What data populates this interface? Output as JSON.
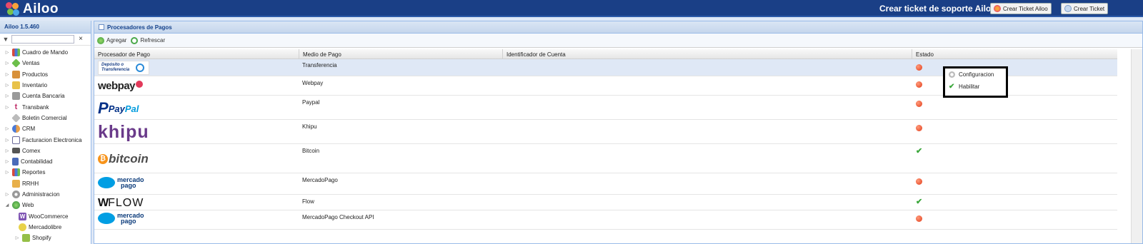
{
  "app": {
    "name": "Ailoo",
    "version": "Ailoo 1.5.460"
  },
  "topbar": {
    "support_text": "Crear ticket de soporte Ailoo ☛",
    "btn_ticket_ailoo": "Crear Ticket Ailoo",
    "btn_ticket": "Crear Ticket"
  },
  "sidebar": {
    "filter_placeholder": "",
    "items": [
      {
        "label": "Cuadro de Mando",
        "icon": "chart-icon",
        "color": "#d84a3a"
      },
      {
        "label": "Ventas",
        "icon": "tag-icon",
        "color": "#6cbf4a"
      },
      {
        "label": "Productos",
        "icon": "box-icon",
        "color": "#d8913a"
      },
      {
        "label": "Inventario",
        "icon": "package-icon",
        "color": "#e8c24a"
      },
      {
        "label": "Cuenta Bancaria",
        "icon": "bank-icon",
        "color": "#8a8a8a"
      },
      {
        "label": "Transbank",
        "icon": "transbank-icon",
        "color": "#c0306a"
      },
      {
        "label": "Boletin Comercial",
        "icon": "tag-gray-icon",
        "color": "#aaaaaa"
      },
      {
        "label": "CRM",
        "icon": "users-icon",
        "color": "#4a7ad8"
      },
      {
        "label": "Facturacion Electronica",
        "icon": "document-icon",
        "color": "#6a6a9a"
      },
      {
        "label": "Comex",
        "icon": "truck-icon",
        "color": "#555555"
      },
      {
        "label": "Contabilidad",
        "icon": "calculator-icon",
        "color": "#4a6ab8"
      },
      {
        "label": "Reportes",
        "icon": "report-icon",
        "color": "#d84a3a"
      },
      {
        "label": "RRHH",
        "icon": "folder-users-icon",
        "color": "#e8b04a"
      },
      {
        "label": "Administracion",
        "icon": "gear-icon",
        "color": "#999999"
      },
      {
        "label": "Web",
        "icon": "globe-icon",
        "color": "#4aa84a"
      },
      {
        "label": "WooCommerce",
        "icon": "woocommerce-icon",
        "color": "#7f54b3"
      },
      {
        "label": "Mercadolibre",
        "icon": "mercadolibre-icon",
        "color": "#e8d24a"
      },
      {
        "label": "Shopify",
        "icon": "shopify-icon",
        "color": "#95bf47"
      }
    ]
  },
  "panel": {
    "title": "Procesadores de Pagos",
    "toolbar": {
      "add": "Agregar",
      "refresh": "Refrescar"
    },
    "columns": [
      "Procesador de Pago",
      "Medio de Pago",
      "Identificador de Cuenta",
      "Estado"
    ],
    "rows": [
      {
        "logo": "Depósito o Transferencia",
        "medio": "Transferencia",
        "identificador": "",
        "estado": "disabled"
      },
      {
        "logo": "webpay",
        "medio": "Webpay",
        "identificador": "",
        "estado": "disabled"
      },
      {
        "logo": "PayPal",
        "medio": "Paypal",
        "identificador": "",
        "estado": "disabled"
      },
      {
        "logo": "khipu",
        "medio": "Khipu",
        "identificador": "",
        "estado": "disabled"
      },
      {
        "logo": "bitcoin",
        "medio": "Bitcoin",
        "identificador": "",
        "estado": "enabled"
      },
      {
        "logo": "mercado pago",
        "medio": "MercadoPago",
        "identificador": "",
        "estado": "disabled"
      },
      {
        "logo": "FLOW",
        "medio": "Flow",
        "identificador": "",
        "estado": "enabled"
      },
      {
        "logo": "mercado pago",
        "medio": "MercadoPago Checkout API",
        "identificador": "",
        "estado": "disabled"
      }
    ]
  },
  "context_menu": {
    "items": [
      {
        "label": "Configuracion",
        "icon": "gear-icon"
      },
      {
        "label": "Habilitar",
        "icon": "check-icon"
      }
    ]
  }
}
